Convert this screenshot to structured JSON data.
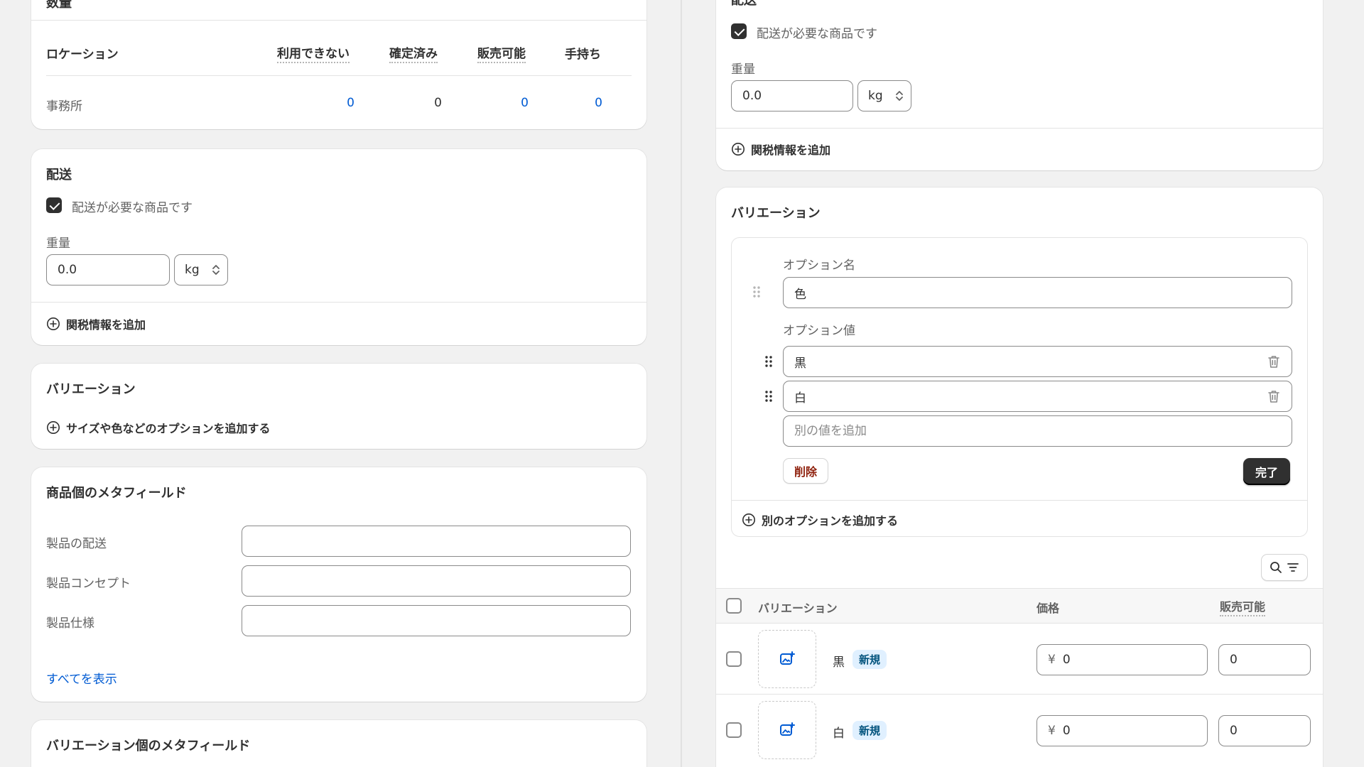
{
  "quantity_card": {
    "title": "数量",
    "columns": {
      "location": "ロケーション",
      "unavailable": "利用できない",
      "committed": "確定済み",
      "available": "販売可能",
      "on_hand": "手持ち"
    },
    "rows": [
      {
        "location": "事務所",
        "unavailable": "0",
        "committed": "0",
        "available": "0",
        "on_hand": "0"
      }
    ]
  },
  "shipping_left": {
    "title": "配送",
    "requires_shipping_label": "配送が必要な商品です",
    "weight_label": "重量",
    "weight_value": "0.0",
    "weight_unit": "kg",
    "add_customs_label": "関税情報を追加"
  },
  "variants_left": {
    "title": "バリエーション",
    "add_options_label": "サイズや色などのオプションを追加する"
  },
  "product_metafields": {
    "title": "商品個のメタフィールド",
    "fields": [
      {
        "label": "製品の配送",
        "value": ""
      },
      {
        "label": "製品コンセプト",
        "value": ""
      },
      {
        "label": "製品仕様",
        "value": ""
      }
    ],
    "show_all_label": "すべてを表示"
  },
  "variant_metafields": {
    "title": "バリエーション個のメタフィールド"
  },
  "shipping_right": {
    "title": "配送",
    "requires_shipping_label": "配送が必要な商品です",
    "weight_label": "重量",
    "weight_value": "0.0",
    "weight_unit": "kg",
    "add_customs_label": "関税情報を追加"
  },
  "variants_right": {
    "title": "バリエーション",
    "option_name_label": "オプション名",
    "option_name_value": "色",
    "option_values_label": "オプション値",
    "option_values": [
      "黒",
      "白"
    ],
    "add_value_placeholder": "別の値を追加",
    "delete_label": "削除",
    "done_label": "完了",
    "add_another_option_label": "別のオプションを追加する",
    "table": {
      "col_variant": "バリエーション",
      "col_price": "価格",
      "col_available": "販売可能",
      "rows": [
        {
          "name": "黒",
          "badge": "新規",
          "currency": "¥",
          "price": "0",
          "available": "0"
        },
        {
          "name": "白",
          "badge": "新規",
          "currency": "¥",
          "price": "0",
          "available": "0"
        }
      ]
    }
  },
  "icons": {
    "plus_circle": "plus-circle-icon",
    "chevron_updown": "chevron-updown-icon",
    "drag_handle": "drag-handle-icon",
    "trash": "trash-icon",
    "search": "search-icon",
    "filter": "filter-icon",
    "image_add": "image-add-icon"
  },
  "colors": {
    "background": "#f1f1f1",
    "card": "#ffffff",
    "link_blue": "#005bd3",
    "primary_button": "#303030",
    "destructive_text": "#8e1f0b",
    "badge_bg": "#e0f0ff"
  }
}
